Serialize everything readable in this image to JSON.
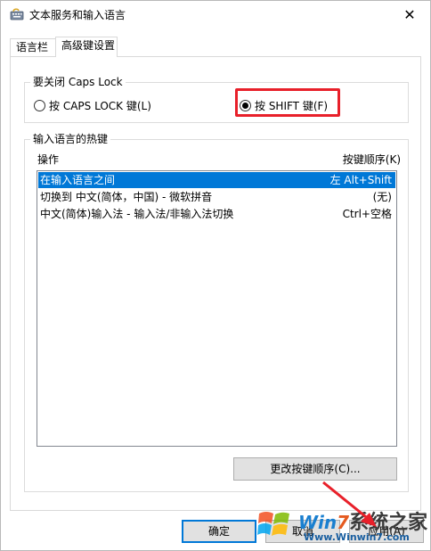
{
  "window": {
    "title": "文本服务和输入语言",
    "close_glyph": "✕"
  },
  "tabs": [
    {
      "label": "语言栏",
      "active": false
    },
    {
      "label": "高级键设置",
      "active": true
    }
  ],
  "caps_lock_group": {
    "legend": "要关闭 Caps Lock",
    "options": [
      {
        "label": "按 CAPS LOCK 键(L)",
        "checked": false
      },
      {
        "label": "按 SHIFT 键(F)",
        "checked": true
      }
    ],
    "highlight_color": "#e8202a"
  },
  "hotkeys_group": {
    "legend": "输入语言的热键",
    "col_action": "操作",
    "col_key_sequence": "按键顺序(K)",
    "rows": [
      {
        "action": "在输入语言之间",
        "keys": "左 Alt+Shift",
        "selected": true
      },
      {
        "action": "切换到 中文(简体，中国) - 微软拼音",
        "keys": "(无)",
        "selected": false
      },
      {
        "action": "中文(简体)输入法 - 输入法/非输入法切换",
        "keys": "Ctrl+空格",
        "selected": false
      }
    ],
    "change_button": "更改按键顺序(C)..."
  },
  "buttons": {
    "ok": "确定",
    "cancel": "取消",
    "apply": "应用(A)"
  },
  "watermark": {
    "brand_prefix": "Win",
    "brand_seven": "7",
    "brand_cn": "系统之家",
    "url": "Www.Winwin7.com"
  },
  "colors": {
    "selection": "#0078d7",
    "annotation": "#e8202a"
  }
}
